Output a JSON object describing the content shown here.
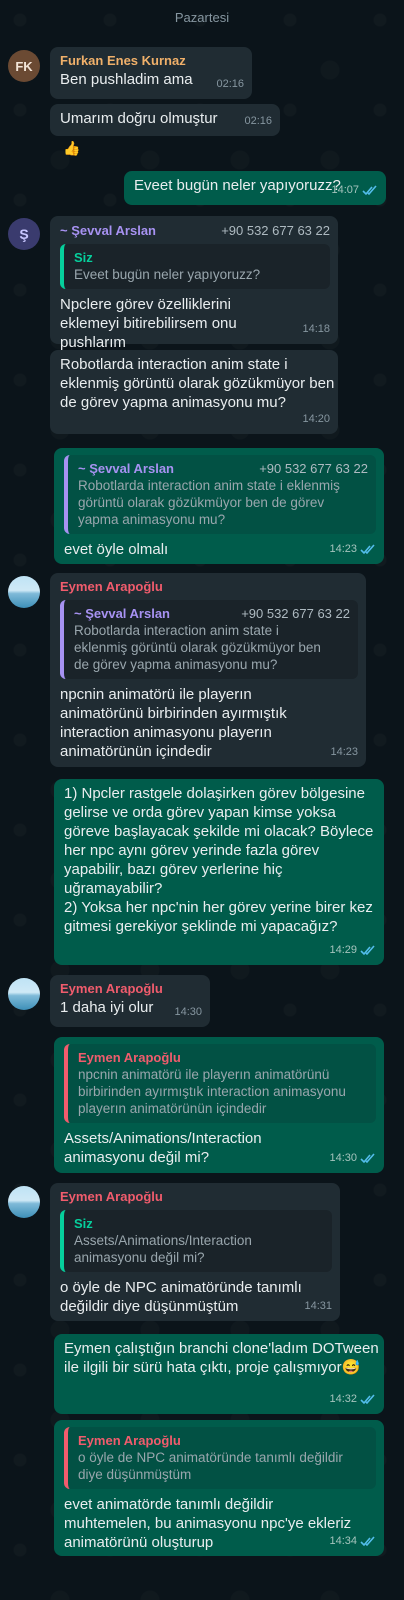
{
  "day_label": "Pazartesi",
  "colors": {
    "incoming": "#202c33",
    "outgoing": "#005c4b",
    "background": "#0b141a",
    "tick_read": "#53bdeb"
  },
  "messages": {
    "m1": {
      "sender": "Furkan Enes Kurnaz",
      "avatar": "FK",
      "text": "Ben pushladim ama",
      "time": "02:16"
    },
    "m2": {
      "text": "Umarım doğru olmuştur",
      "time": "02:16",
      "reaction": "👍"
    },
    "m3": {
      "text": "Eveet bugün neler yapıyoruzz?",
      "time": "14:07",
      "status": "read"
    },
    "m4": {
      "sender": "~ Şevval Arslan",
      "phone": "+90 532 677 63 22",
      "avatar": "Ş",
      "quote_author": "Siz",
      "quote_text": "Eveet bugün neler yapıyoruzz?",
      "text": "Npclere görev özelliklerini eklemeyi bitirebilirsem onu pushlarım",
      "time": "14:18"
    },
    "m5": {
      "text": "Robotlarda interaction anim state i eklenmiş görüntü olarak gözükmüyor ben de görev yapma animasyonu mu?",
      "time": "14:20"
    },
    "m6": {
      "quote_author": "~ Şevval Arslan",
      "quote_phone": "+90 532 677 63 22",
      "quote_text": "Robotlarda interaction anim state i eklenmiş görüntü olarak gözükmüyor ben de görev yapma animasyonu mu?",
      "text": "evet öyle olmalı",
      "time": "14:23",
      "status": "read"
    },
    "m7": {
      "sender": "Eymen Arapoğlu",
      "quote_author": "~ Şevval Arslan",
      "quote_phone": "+90 532 677 63 22",
      "quote_text": "Robotlarda interaction anim state i eklenmiş görüntü olarak gözükmüyor ben de görev yapma animasyonu mu?",
      "text": "npcnin animatörü ile playerın animatörünü birbirinden ayırmıştık interaction animasyonu playerın animatörünün içindedir",
      "time": "14:23"
    },
    "m8": {
      "text": "1) Npcler rastgele dolaşirken görev bölgesine gelirse ve orda görev yapan kimse yoksa göreve başlayacak şekilde mi olacak? Böylece her npc aynı görev yerinde fazla görev yapabilir, bazı görev yerlerine hiç uğramayabilir?\n2) Yoksa her npc'nin her görev yerine birer kez gitmesi gerekiyor şeklinde mi yapacağız?",
      "time": "14:29",
      "status": "read"
    },
    "m9": {
      "sender": "Eymen Arapoğlu",
      "text": "1 daha iyi olur",
      "time": "14:30"
    },
    "m10": {
      "quote_author": "Eymen Arapoğlu",
      "quote_text": "npcnin animatörü ile playerın animatörünü birbirinden ayırmıştık interaction animasyonu playerın animatörünün içindedir",
      "text": "Assets/Animations/Interaction animasyonu değil mi?",
      "time": "14:30",
      "status": "read"
    },
    "m11": {
      "sender": "Eymen Arapoğlu",
      "quote_author": "Siz",
      "quote_text": "Assets/Animations/Interaction animasyonu değil mi?",
      "text": "o öyle de NPC animatöründe tanımlı değildir diye düşünmüştüm",
      "time": "14:31"
    },
    "m12": {
      "text": "Eymen çalıştığın branchi clone'ladım DOTween ile ilgili bir sürü hata çıktı, proje çalışmıyor😅",
      "time": "14:32",
      "status": "read"
    },
    "m13": {
      "quote_author": "Eymen Arapoğlu",
      "quote_text": "o öyle de NPC animatöründe tanımlı değildir diye düşünmüştüm",
      "text": "evet animatörde tanımlı değildir muhtemelen, bu animasyonu npc'ye ekleriz animatörünü oluşturup",
      "time": "14:34",
      "status": "read"
    }
  }
}
